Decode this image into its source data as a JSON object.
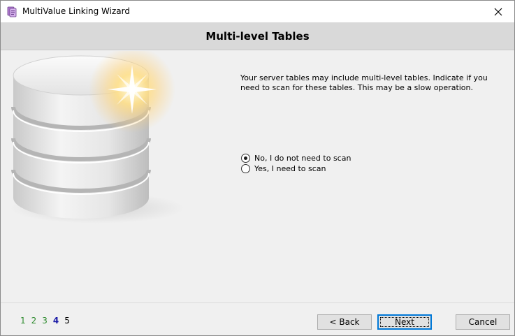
{
  "window": {
    "title": "MultiValue Linking Wizard"
  },
  "header": {
    "title": "Multi-level Tables"
  },
  "content": {
    "instruction": "Your server tables may include multi-level tables.  Indicate if you need to scan for these tables. This may be a slow operation.",
    "options": [
      {
        "label": "No, I do not need to scan",
        "selected": true
      },
      {
        "label": "Yes, I need to scan",
        "selected": false
      }
    ]
  },
  "steps": {
    "items": [
      "1",
      "2",
      "3",
      "4",
      "5"
    ],
    "current": 4
  },
  "buttons": {
    "back": "< Back",
    "next": "Next",
    "cancel": "Cancel"
  },
  "colors": {
    "header_band": "#d9d9d9",
    "step_done": "#2e8b2e",
    "step_current": "#1a1aa6",
    "default_button_border": "#0078d7"
  },
  "icons": {
    "app": "app-wizard-icon",
    "close": "close-icon",
    "illustration": "database-icon"
  }
}
